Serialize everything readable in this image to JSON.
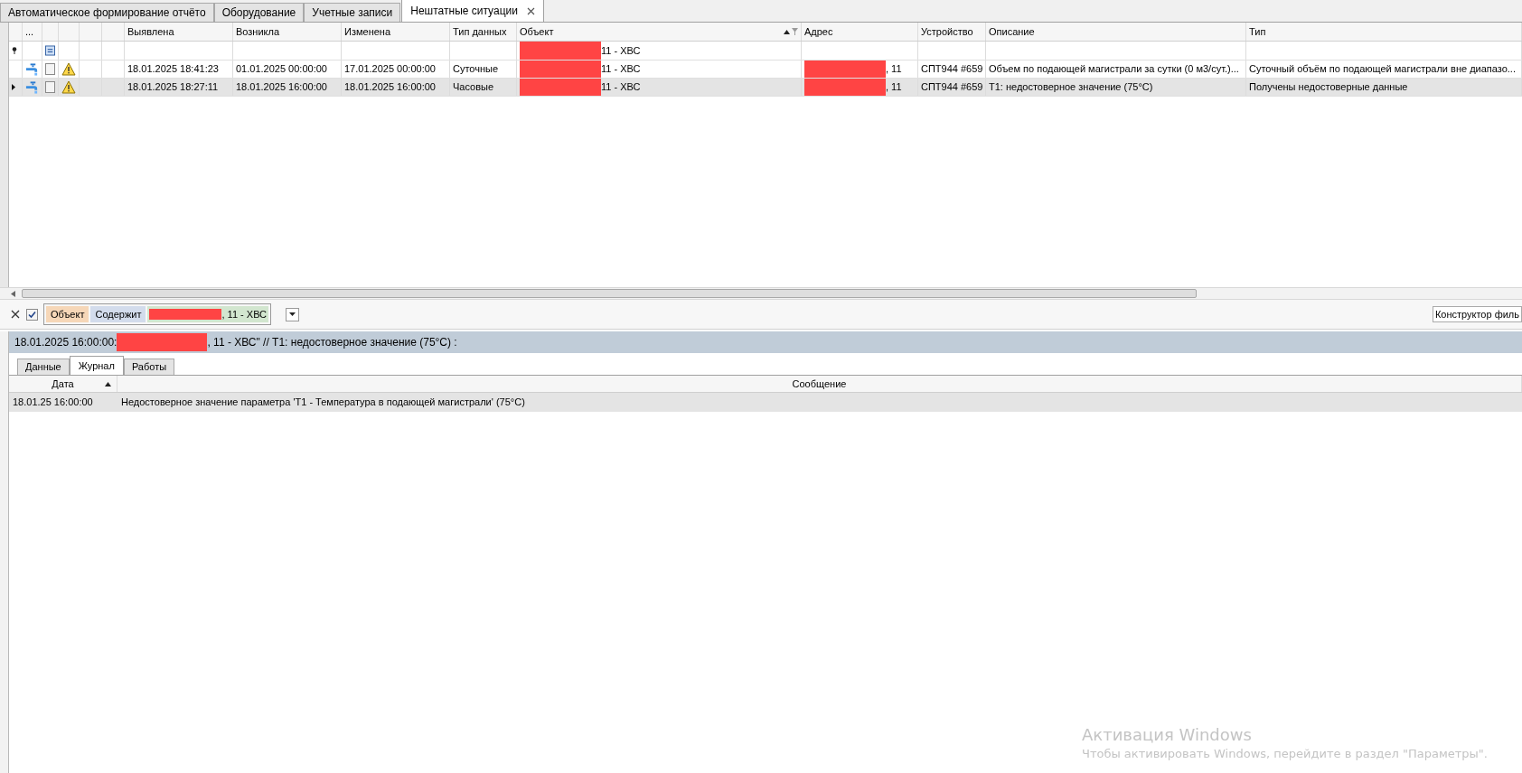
{
  "tabs": [
    {
      "label": "Автоматическое формирование отчёто",
      "selected": false
    },
    {
      "label": "Оборудование",
      "selected": false
    },
    {
      "label": "Учетные записи",
      "selected": false
    },
    {
      "label": "Нештатные ситуации",
      "selected": true
    }
  ],
  "grid": {
    "selector_header": "...",
    "columns": [
      {
        "label": "Выявлена",
        "sorted": false,
        "filtered": false
      },
      {
        "label": "Возникла",
        "sorted": false,
        "filtered": false
      },
      {
        "label": "Изменена",
        "sorted": false,
        "filtered": false
      },
      {
        "label": "Тип данных",
        "sorted": false,
        "filtered": false
      },
      {
        "label": "Объект",
        "sorted": true,
        "filtered": true
      },
      {
        "label": "Адрес",
        "sorted": false,
        "filtered": false
      },
      {
        "label": "Устройство",
        "sorted": false,
        "filtered": false
      },
      {
        "label": "Описание",
        "sorted": false,
        "filtered": false
      },
      {
        "label": "Тип",
        "sorted": false,
        "filtered": false
      }
    ],
    "filter_row": {
      "object": "11 - ХВС"
    },
    "rows": [
      {
        "selected": false,
        "current": false,
        "checked": false,
        "cells": [
          "18.01.2025 18:41:23",
          "01.01.2025 00:00:00",
          "17.01.2025 00:00:00",
          "Суточные",
          "11 - ХВС",
          ", 11",
          "СПТ944 #659",
          "Объем по подающей магистрали за сутки (0 м3/сут.)...",
          "Суточный объём по подающей магистрали вне диапазо..."
        ]
      },
      {
        "selected": true,
        "current": true,
        "checked": false,
        "cells": [
          "18.01.2025 18:27:11",
          "18.01.2025 16:00:00",
          "18.01.2025 16:00:00",
          "Часовые",
          "11 - ХВС",
          ", 11",
          "СПТ944 #659",
          "Т1: недостоверное значение (75°С)",
          "Получены недостоверные данные"
        ]
      }
    ]
  },
  "filter_bar": {
    "enabled": true,
    "field": "Объект",
    "operator": "Содержит",
    "value": ", 11 - ХВС",
    "builder_button": "Конструктор филь"
  },
  "detail": {
    "title_start": "18.01.2025 16:00:00:",
    "title_end": ", 11 - ХВС\" // Т1: недостоверное значение (75°С) :",
    "tabs": [
      {
        "label": "Данные",
        "selected": false
      },
      {
        "label": "Журнал",
        "selected": true
      },
      {
        "label": "Работы",
        "selected": false
      }
    ],
    "journal": {
      "columns": [
        {
          "label": "Дата",
          "sorted": true
        },
        {
          "label": "Сообщение",
          "sorted": false
        }
      ],
      "rows": [
        {
          "selected": true,
          "cells": [
            "18.01.25 16:00:00",
            "Недостоверное значение параметра 'Т1 - Температура в подающей магистрали' (75°С)"
          ]
        }
      ]
    }
  },
  "activation": {
    "title": "Активация Windows",
    "text": "Чтобы активировать Windows, перейдите в раздел \"Параметры\"."
  }
}
